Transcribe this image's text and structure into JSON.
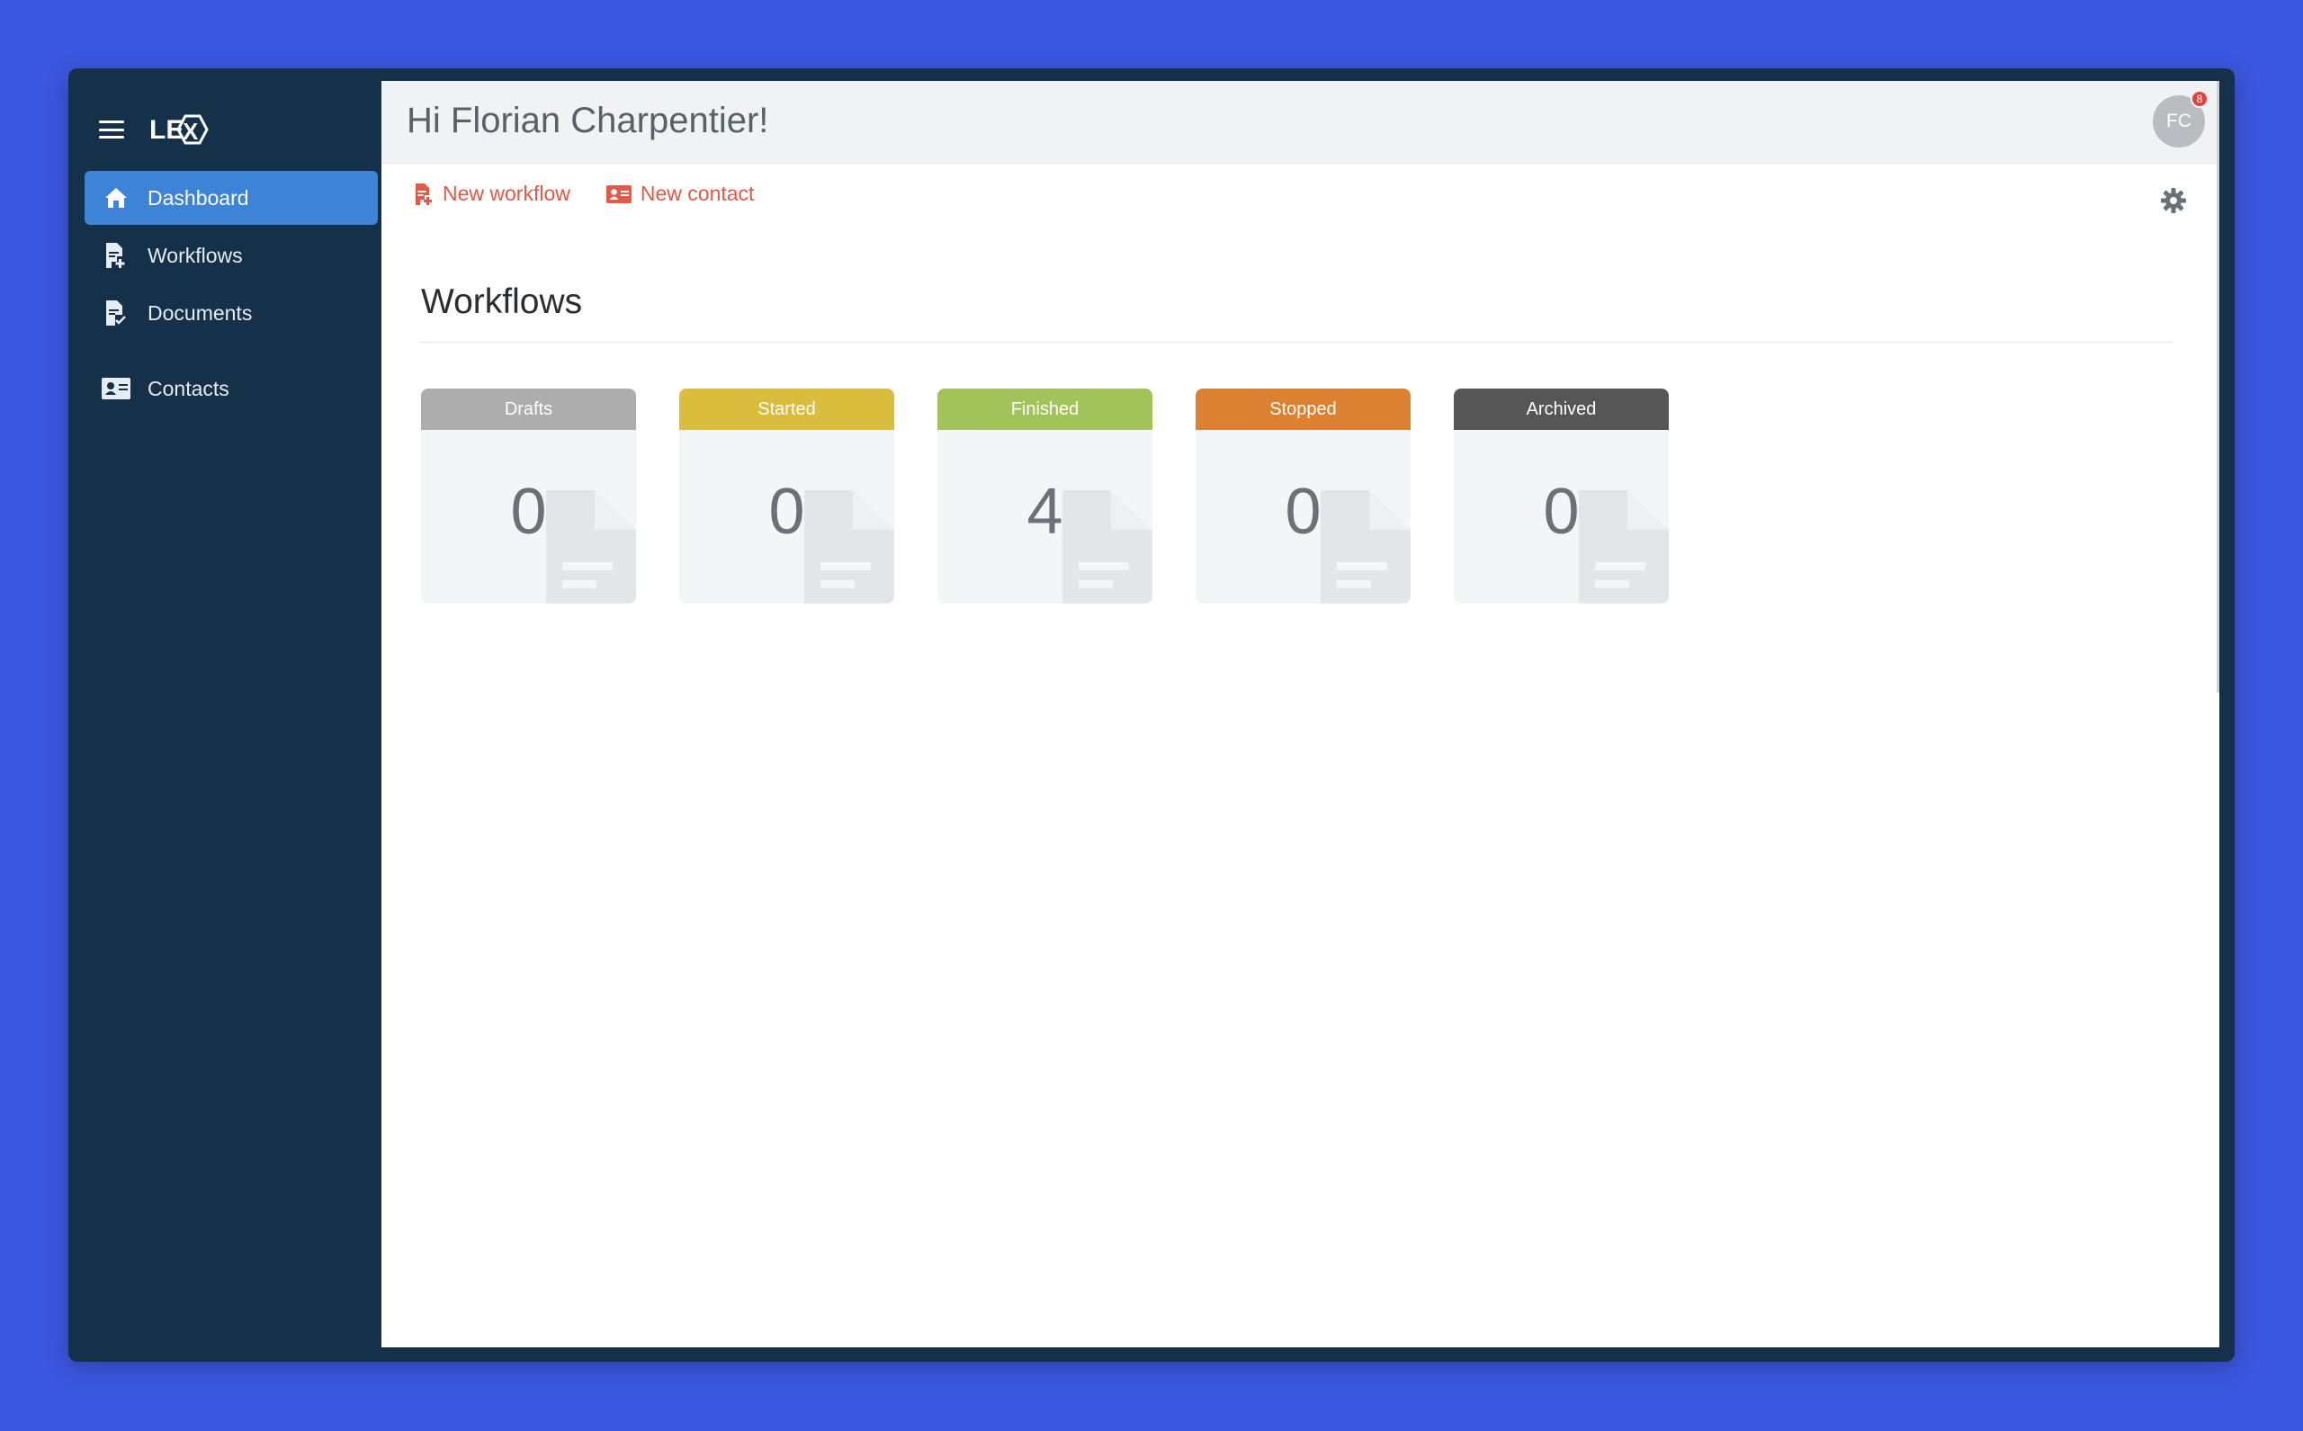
{
  "app": {
    "logo_text": "LEX"
  },
  "sidebar": {
    "items": [
      {
        "label": "Dashboard",
        "icon": "home-icon",
        "active": true
      },
      {
        "label": "Workflows",
        "icon": "file-add-icon",
        "active": false
      },
      {
        "label": "Documents",
        "icon": "file-check-icon",
        "active": false
      },
      {
        "label": "Contacts",
        "icon": "contact-card-icon",
        "active": false
      }
    ]
  },
  "header": {
    "greeting": "Hi Florian Charpentier!",
    "avatar_initials": "FC",
    "notification_count": "8"
  },
  "actions": {
    "new_workflow": "New workflow",
    "new_contact": "New contact"
  },
  "workflows": {
    "title": "Workflows",
    "cards": [
      {
        "label": "Drafts",
        "count": "0",
        "color": "#adadad"
      },
      {
        "label": "Started",
        "count": "0",
        "color": "#dabd3c"
      },
      {
        "label": "Finished",
        "count": "4",
        "color": "#a2c25a"
      },
      {
        "label": "Stopped",
        "count": "0",
        "color": "#dc8131"
      },
      {
        "label": "Archived",
        "count": "0",
        "color": "#565656"
      }
    ]
  },
  "colors": {
    "background": "#3b57df",
    "sidebar": "#143149",
    "active": "#3d83d8",
    "action": "#e05a47"
  }
}
